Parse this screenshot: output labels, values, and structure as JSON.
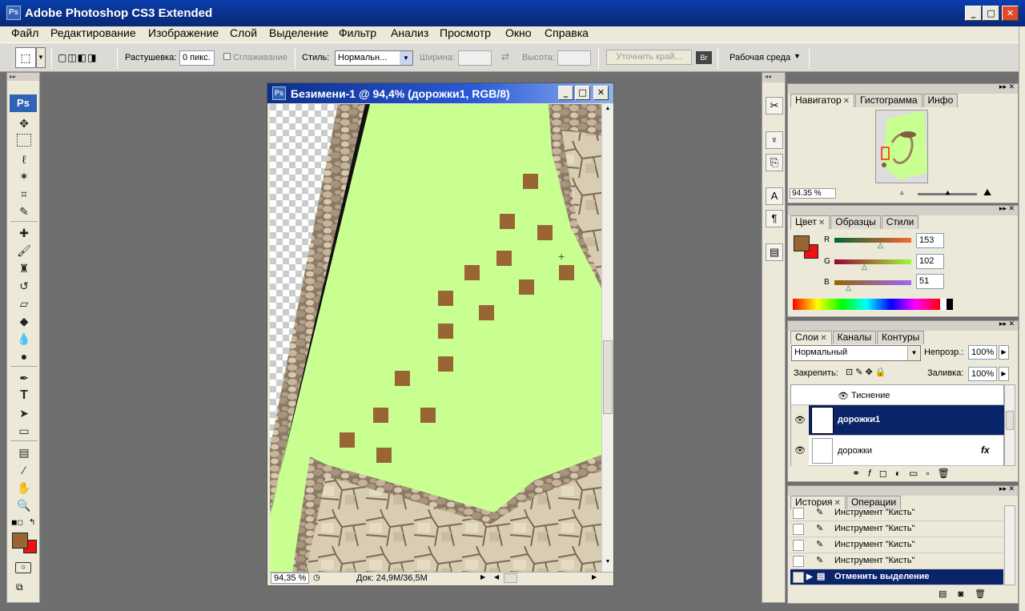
{
  "window": {
    "title": "Adobe Photoshop CS3 Extended",
    "logo": "Ps",
    "minimize": "_",
    "maximize": "□",
    "close": "✕"
  },
  "menu": [
    "Файл",
    "Редактирование",
    "Изображение",
    "Слой",
    "Выделение",
    "Фильтр",
    "Анализ",
    "Просмотр",
    "Окно",
    "Справка"
  ],
  "options": {
    "feather_label": "Растушевка:",
    "feather_value": "0 пикс.",
    "antialias_label": "Сглаживание",
    "style_label": "Стиль:",
    "style_value": "Нормальн...",
    "width_label": "Ширина:",
    "height_label": "Высота:",
    "refine_edge": "Уточнить край...",
    "workspace": "Рабочая среда"
  },
  "toolbox": {
    "logo": "Ps"
  },
  "document": {
    "title": "Безимени-1 @ 94,4% (дорожки1, RGB/8)",
    "zoom": "94,35 %",
    "doc_size": "Док: 24,9M/36,5M"
  },
  "navigator": {
    "tabs": [
      "Навигатор",
      "Гистограмма",
      "Инфо"
    ],
    "zoom": "94.35 %"
  },
  "color": {
    "tabs": [
      "Цвет",
      "Образцы",
      "Стили"
    ],
    "r_label": "R",
    "r_value": "153",
    "g_label": "G",
    "g_value": "102",
    "b_label": "B",
    "b_value": "51",
    "foreground": "#996633",
    "background": "#ee1111"
  },
  "layers": {
    "tabs": [
      "Слои",
      "Каналы",
      "Контуры"
    ],
    "blend_mode": "Нормальный",
    "opacity_label": "Непрозр.:",
    "opacity_value": "100%",
    "lock_label": "Закрепить:",
    "fill_label": "Заливка:",
    "fill_value": "100%",
    "effect_name": "Тиснение",
    "items": [
      {
        "name": "дорожки1",
        "selected": true
      },
      {
        "name": "дорожки",
        "selected": false,
        "fx": "fx"
      }
    ]
  },
  "history": {
    "tabs": [
      "История",
      "Операции"
    ],
    "items": [
      {
        "label": "Инструмент \"Кисть\""
      },
      {
        "label": "Инструмент \"Кисть\""
      },
      {
        "label": "Инструмент \"Кисть\""
      },
      {
        "label": "Инструмент \"Кисть\""
      },
      {
        "label": "Отменить выделение",
        "selected": true
      }
    ]
  }
}
